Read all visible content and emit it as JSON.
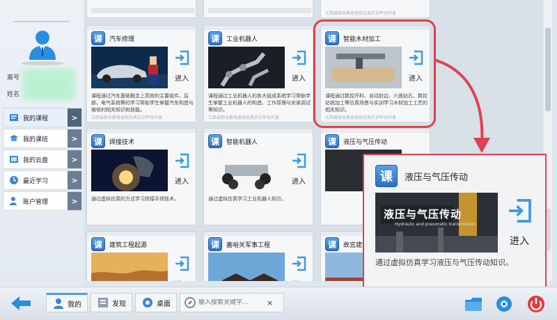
{
  "sidebar": {
    "label_name": "离号",
    "label_real": "姓名",
    "menu": [
      {
        "label": "我的课程",
        "icon": "course-icon",
        "active": true
      },
      {
        "label": "我的课班",
        "icon": "class-icon",
        "active": false
      },
      {
        "label": "我的云盘",
        "icon": "cloud-disk-icon",
        "active": false
      },
      {
        "label": "最近学习",
        "icon": "recent-icon",
        "active": false
      },
      {
        "label": "账户管理",
        "icon": "account-icon",
        "active": false
      }
    ]
  },
  "cards": [
    {
      "title": "汽车修理",
      "enter": "进入",
      "desc": "课程通过汽车基础概念上高效的主要组件，后部，电气系统等的学习帮助学生掌握汽车构造与维修的相关知识和技能。",
      "foot": "江西省职业教育虚拟仿真实训平台开发",
      "img": "car"
    },
    {
      "title": "工业机器人",
      "enter": "进入",
      "desc": "课程通过工业机器人的各大组成系统学习帮助学生掌握工业机器人的构造、工作原理与安装调试等知识。",
      "foot": "江西省职业教育虚拟仿真实训平台开发",
      "img": "robot"
    },
    {
      "title": "智能木材加工",
      "enter": "进入",
      "desc": "课程通过数控开料、自动封边、六面钻孔、数控钻铣加工等仿真场景与实训学习木材加工工艺的相关知识。",
      "foot": "江西省职业教育虚拟仿真实训平台开发",
      "img": "wood"
    },
    {
      "title": "焊接技术",
      "enter": "进入",
      "desc": "通过虚拟仿真的方式学习焊接手焊技术。",
      "foot": "",
      "img": "weld"
    },
    {
      "title": "智能机器人",
      "enter": "进入",
      "desc": "通过虚拟仿真学习工业机器人知识。",
      "foot": "",
      "img": "rover"
    },
    {
      "title": "液压与气压传动",
      "enter": "进入",
      "desc": "",
      "foot": "",
      "img": "hydraulic"
    },
    {
      "title": "建筑工程起源",
      "enter": "进入",
      "desc": "",
      "foot": "",
      "img": "terrace"
    },
    {
      "title": "嘉峪关军事工程",
      "enter": "进入",
      "desc": "",
      "foot": "",
      "img": "pagoda"
    },
    {
      "title": "故宫建筑",
      "enter": "",
      "desc": "",
      "foot": "",
      "img": "palace"
    }
  ],
  "top_foot": "江西省职业教育虚拟仿真实训平台开发",
  "zoom": {
    "title": "液压与气压传动",
    "img_title": "液压与气压传动",
    "img_subtitle": "Hydraulic and pneumatic transmission",
    "enter": "进入",
    "desc": "通过虚拟仿真学习液压与气压传动知识。"
  },
  "bottombar": {
    "tabs": [
      {
        "label": "我的",
        "icon": "user-icon"
      },
      {
        "label": "发现",
        "icon": "discover-icon"
      },
      {
        "label": "桌面",
        "icon": "desktop-icon"
      }
    ],
    "search_placeholder": "输入搜索关键字…",
    "close": "×"
  },
  "colors": {
    "accent": "#2d6fbe",
    "highlight": "#e04050"
  }
}
